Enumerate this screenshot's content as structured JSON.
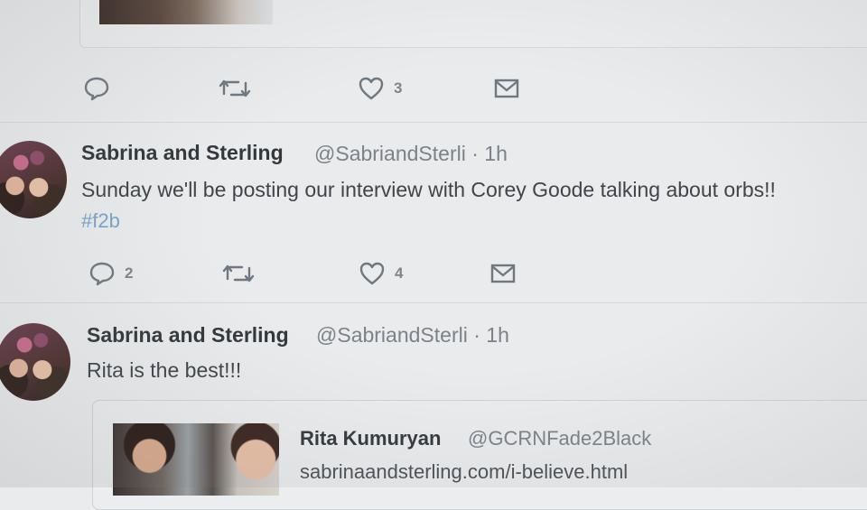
{
  "previous_tweet": {
    "like_count": "3"
  },
  "tweets": [
    {
      "name": "Sabrina and Sterling",
      "handle": "@SabriandSterli",
      "separator": "·",
      "time": "1h",
      "text": "Sunday we'll be posting our interview with Corey Goode talking about orbs!!",
      "hashtag": "#f2b",
      "reply_count": "2",
      "like_count": "4"
    },
    {
      "name": "Sabrina and Sterling",
      "handle": "@SabriandSterli",
      "separator": "·",
      "time": "1h",
      "text": "Rita is the best!!!",
      "quoted": {
        "name": "Rita Kumuryan",
        "handle": "@GCRNFade2Black",
        "link": "sabrinaandsterling.com/i-believe.html"
      }
    }
  ],
  "icons": {
    "reply": "reply-icon",
    "retweet": "retweet-icon",
    "like": "heart-icon",
    "message": "envelope-icon"
  }
}
